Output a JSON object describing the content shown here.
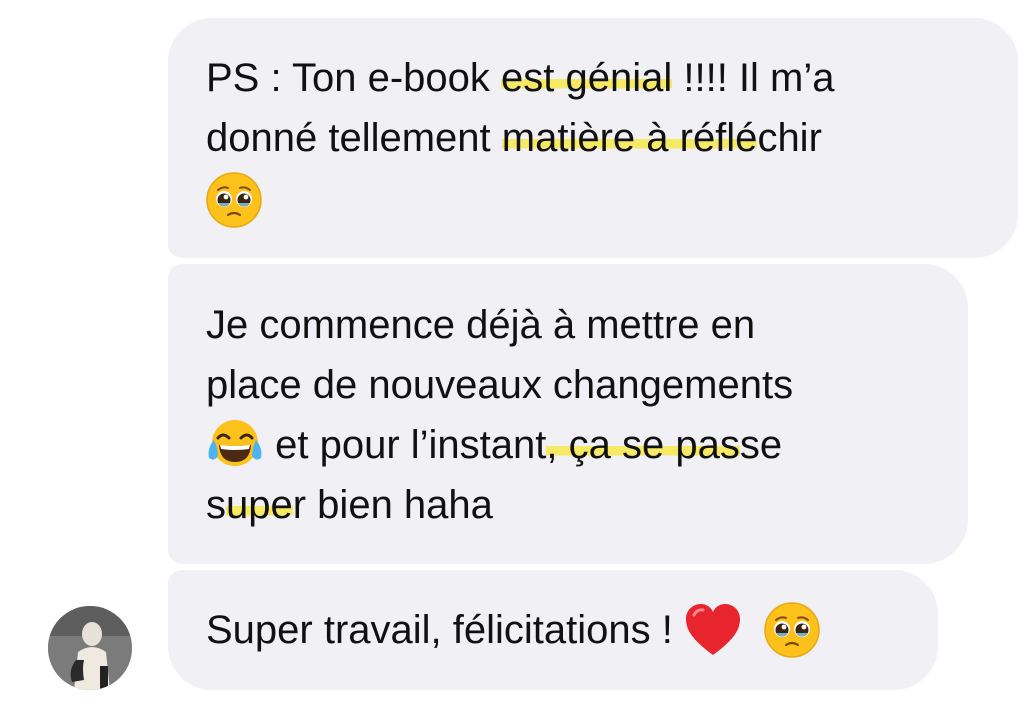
{
  "messages": [
    {
      "parts": [
        {
          "text": "PS : Ton e-book ",
          "hl": false
        },
        {
          "text": "est génial",
          "hl": true
        },
        {
          "text": " !!!! Il m’a",
          "hl": false
        },
        {
          "text": "donné tellement ",
          "hl": false
        },
        {
          "text": "matière à réflé",
          "hl": true
        },
        {
          "text": "chir",
          "hl": false
        }
      ],
      "emoji": "pleading-face"
    },
    {
      "line1": "Je commence déjà à mettre en",
      "line2": "place de nouveaux changements",
      "emoji": "tears-of-joy-face",
      "line3_a": " et pour l’instant",
      "line3_hl": ", ça se pas",
      "line3_b": "se",
      "line4_a": "s",
      "line4_hl": "upe",
      "line4_b": "r bien haha"
    },
    {
      "text": "Super travail, félicitations ! ",
      "emojis": [
        "red-heart",
        "pleading-face"
      ]
    }
  ],
  "colors": {
    "bubble": "#f0f0f5",
    "text": "#111111",
    "highlight": "#f7e94b"
  }
}
